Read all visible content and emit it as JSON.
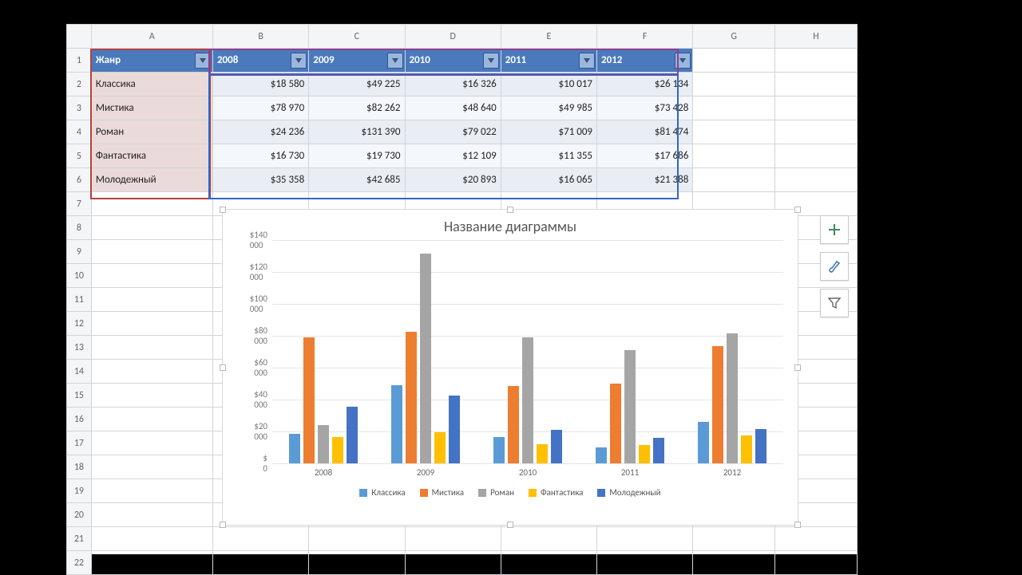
{
  "columns": [
    "A",
    "B",
    "C",
    "D",
    "E",
    "F",
    "G",
    "H"
  ],
  "header": {
    "genre": "Жанр",
    "y0": "2008",
    "y1": "2009",
    "y2": "2010",
    "y3": "2011",
    "y4": "2012"
  },
  "rows": [
    {
      "g": "Классика",
      "v": [
        "$18 580",
        "$49 225",
        "$16 326",
        "$10 017",
        "$26 134"
      ]
    },
    {
      "g": "Мистика",
      "v": [
        "$78 970",
        "$82 262",
        "$48 640",
        "$49 985",
        "$73 428"
      ]
    },
    {
      "g": "Роман",
      "v": [
        "$24 236",
        "$131 390",
        "$79 022",
        "$71 009",
        "$81 474"
      ]
    },
    {
      "g": "Фантастика",
      "v": [
        "$16 730",
        "$19 730",
        "$12 109",
        "$11 355",
        "$17 686"
      ]
    },
    {
      "g": "Молодежный",
      "v": [
        "$35 358",
        "$42 685",
        "$20 893",
        "$16 065",
        "$21 388"
      ]
    }
  ],
  "chart_data": {
    "type": "bar",
    "title": "Название диаграммы",
    "categories": [
      "2008",
      "2009",
      "2010",
      "2011",
      "2012"
    ],
    "series": [
      {
        "name": "Классика",
        "values": [
          18580,
          49225,
          16326,
          10017,
          26134
        ],
        "color": "#5b9bd5"
      },
      {
        "name": "Мистика",
        "values": [
          78970,
          82262,
          48640,
          49985,
          73428
        ],
        "color": "#ed7d31"
      },
      {
        "name": "Роман",
        "values": [
          24236,
          131390,
          79022,
          71009,
          81474
        ],
        "color": "#a5a5a5"
      },
      {
        "name": "Фантастика",
        "values": [
          16730,
          19730,
          12109,
          11355,
          17686
        ],
        "color": "#ffc000"
      },
      {
        "name": "Молодежный",
        "values": [
          35358,
          42685,
          20893,
          16065,
          21388
        ],
        "color": "#4472c4"
      }
    ],
    "ylim": [
      0,
      140000
    ],
    "yticks": [
      "$ 0",
      "$20 000",
      "$40 000",
      "$60 000",
      "$80 000",
      "$100 000",
      "$120 000",
      "$140 000"
    ]
  },
  "sidebtn_tips": {
    "add": "+",
    "brush": "brush",
    "filter": "filter"
  }
}
